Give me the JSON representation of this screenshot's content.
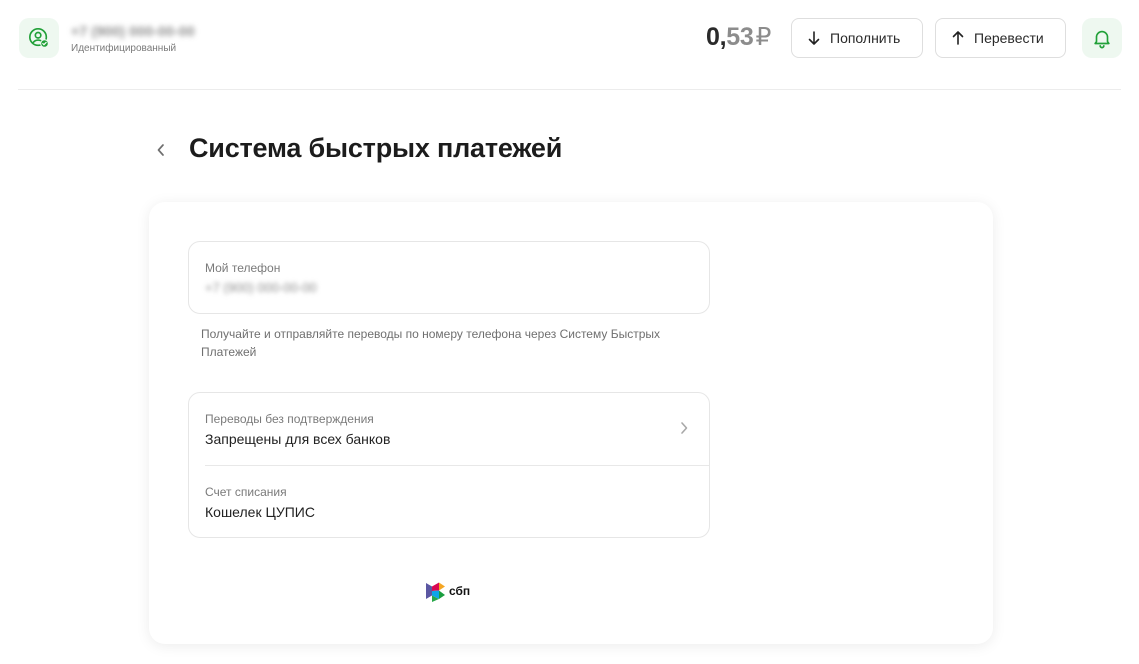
{
  "header": {
    "user_phone": "+7 (900) 000-00-00",
    "user_status": "Идентифицированный",
    "balance_integer": "0,",
    "balance_fraction": "53",
    "balance_currency": "₽",
    "topup_label": "Пополнить",
    "transfer_label": "Перевести",
    "icons": {
      "avatar": "user-verified-icon",
      "topup": "arrow-down-icon",
      "transfer": "arrow-up-icon",
      "notifications": "bell-icon"
    }
  },
  "page": {
    "title": "Система быстрых платежей",
    "back_icon": "chevron-left-icon"
  },
  "phone_section": {
    "label": "Мой телефон",
    "value": "+7 (900) 000-00-00"
  },
  "hint": "Получайте и отправляйте переводы по номеру телефона через Систему Быстрых Платежей",
  "settings": {
    "rows": [
      {
        "label": "Переводы без подтверждения",
        "value": "Запрещены для всех банков"
      },
      {
        "label": "Счет списания",
        "value": "Кошелек ЦУПИС"
      }
    ]
  },
  "footer_logo": {
    "text": "сбп",
    "icon": "sbp-logo-icon"
  },
  "colors": {
    "accent_green": "#21a038",
    "accent_green_bg": "#eef8f0",
    "text_primary": "#1c1c1c",
    "text_secondary": "#7a7a7a",
    "border": "#e6e6e6"
  }
}
